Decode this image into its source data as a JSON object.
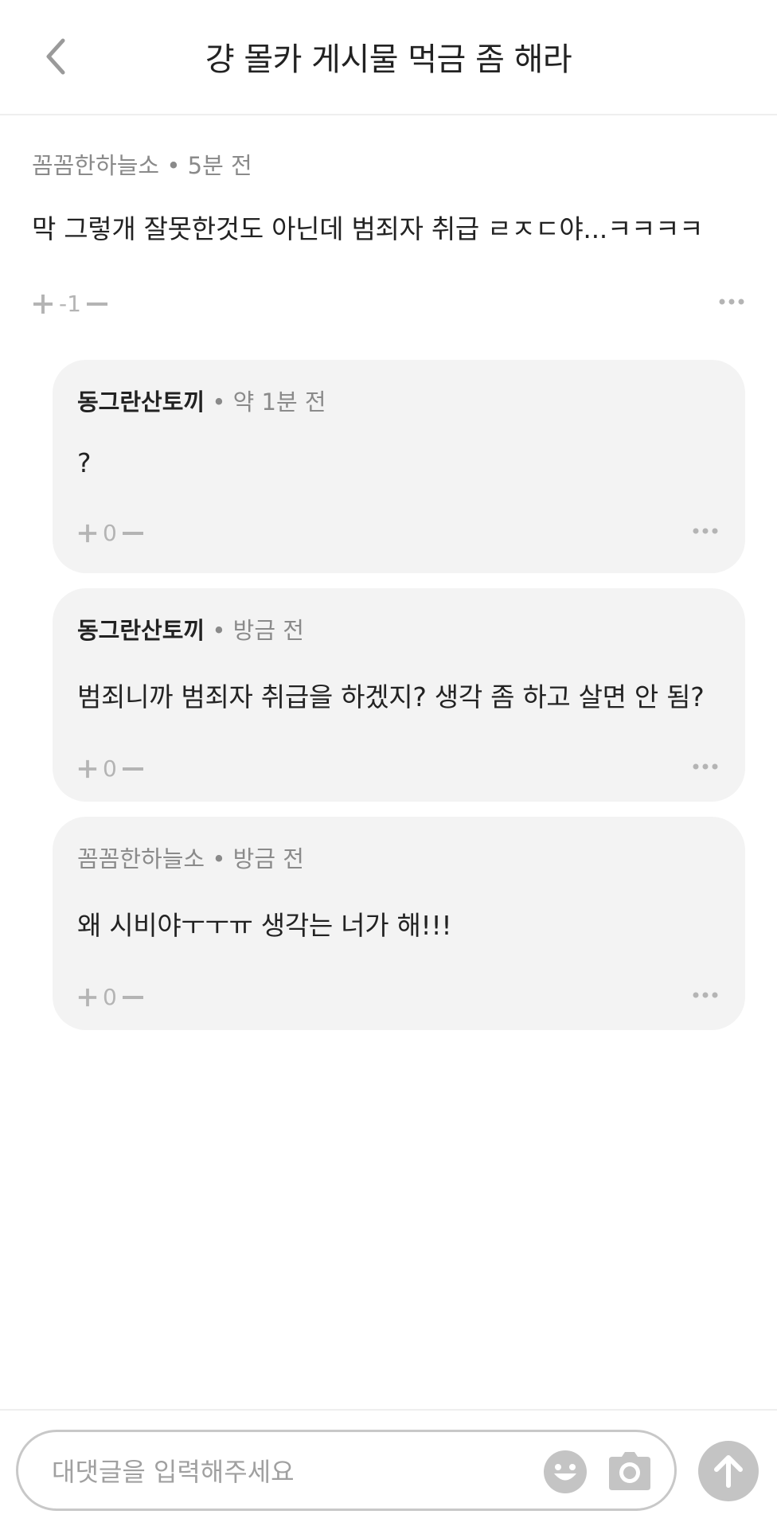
{
  "header": {
    "back_icon": "chevron-left-icon",
    "title": "걍 몰카 게시물  먹금 좀 해라"
  },
  "parent_comment": {
    "author": "꼼꼼한하늘소",
    "time": "5분 전",
    "text": "막 그렇개 잘못한것도 아닌데 범죄자 취급 ㄹㅈㄷ야...ㅋㅋㅋㅋ",
    "score": "-1"
  },
  "replies": [
    {
      "author": "동그란산토끼",
      "author_bold": true,
      "time": "약 1분 전",
      "text": "?",
      "score": "0"
    },
    {
      "author": "동그란산토끼",
      "author_bold": true,
      "time": "방금 전",
      "text": "범죄니까 범죄자 취급을 하겠지? 생각 좀 하고 살면 안 됨?",
      "score": "0"
    },
    {
      "author": "꼼꼼한하늘소",
      "author_bold": false,
      "time": "방금 전",
      "text": "왜 시비야ㅜㅜㅠ 생각는 너가 해!!!",
      "score": "0"
    }
  ],
  "meta_separator": "•",
  "input": {
    "placeholder": "대댓글을 입력해주세요",
    "emoji_icon": "smiley-icon",
    "camera_icon": "camera-icon",
    "send_icon": "arrow-up-icon"
  },
  "colors": {
    "text": "#222222",
    "muted": "#8a8a8a",
    "icon_gray": "#b4b4b4",
    "card_bg": "#f3f3f3",
    "send_bg": "#c4c4c4"
  }
}
